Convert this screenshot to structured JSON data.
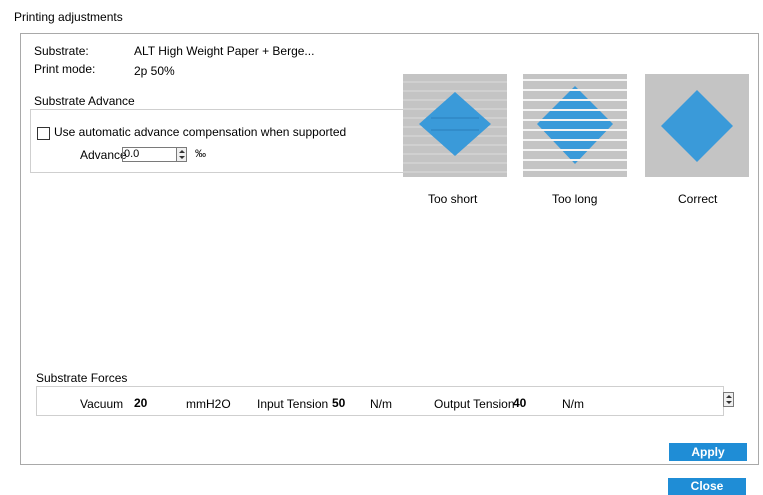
{
  "dialog": {
    "title": "Printing adjustments"
  },
  "info": {
    "substrate_label": "Substrate:",
    "substrate_value": "ALT High Weight Paper + Berge...",
    "print_mode_label": "Print mode:",
    "print_mode_value": "2p 50%"
  },
  "advance": {
    "group_label": "Substrate Advance",
    "checkbox_label": "Use automatic advance compensation when supported",
    "checkbox_checked": false,
    "advance_label": "Advance",
    "advance_value": "0.0",
    "unit": "‰"
  },
  "illustrations": [
    {
      "caption": "Too short"
    },
    {
      "caption": "Too long"
    },
    {
      "caption": "Correct"
    }
  ],
  "forces": {
    "group_label": "Substrate Forces",
    "vacuum_label": "Vacuum",
    "vacuum_value": "20",
    "vacuum_unit": "mmH2O",
    "input_label": "Input Tension",
    "input_value": "50",
    "input_unit": "N/m",
    "output_label": "Output Tension",
    "output_value": "40",
    "output_unit": "N/m"
  },
  "buttons": {
    "apply": "Apply",
    "close": "Close"
  },
  "colors": {
    "accent": "#1f8dd6",
    "diamond": "#3a9ad9",
    "panel_gray": "#c4c4c4"
  }
}
